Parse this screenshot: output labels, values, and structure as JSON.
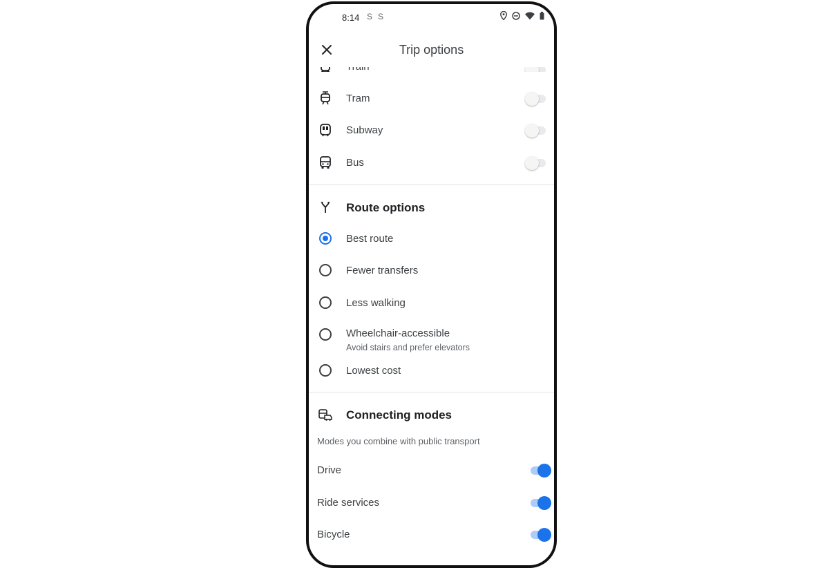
{
  "status_bar": {
    "time": "8:14",
    "left_icons": [
      "notification-s-icon",
      "notification-s-icon"
    ],
    "right_icons": [
      "location-icon",
      "do-not-disturb-icon",
      "wifi-icon",
      "battery-icon"
    ]
  },
  "header": {
    "title": "Trip options",
    "close_icon": "close-icon"
  },
  "transit_modes": [
    {
      "label": "Train",
      "icon": "train-icon",
      "enabled": false
    },
    {
      "label": "Tram",
      "icon": "tram-icon",
      "enabled": false
    },
    {
      "label": "Subway",
      "icon": "subway-icon",
      "enabled": false
    },
    {
      "label": "Bus",
      "icon": "bus-icon",
      "enabled": false
    }
  ],
  "route_options": {
    "title": "Route options",
    "icon": "fork-route-icon",
    "selected": "Best route",
    "items": [
      {
        "label": "Best route",
        "selected": true
      },
      {
        "label": "Fewer transfers",
        "selected": false
      },
      {
        "label": "Less walking",
        "selected": false
      },
      {
        "label": "Wheelchair-accessible",
        "sublabel": "Avoid stairs and prefer elevators",
        "selected": false
      },
      {
        "label": "Lowest cost",
        "selected": false
      }
    ]
  },
  "connecting_modes": {
    "title": "Connecting modes",
    "icon": "car-transit-icon",
    "description": "Modes you combine with public transport",
    "items": [
      {
        "label": "Drive",
        "enabled": true
      },
      {
        "label": "Ride services",
        "enabled": true
      },
      {
        "label": "Bicycle",
        "enabled": true
      }
    ]
  },
  "colors": {
    "accent": "#1a73e8",
    "accent_track": "#aecbfa",
    "text_primary": "#202124",
    "text_secondary": "#5f6368"
  }
}
